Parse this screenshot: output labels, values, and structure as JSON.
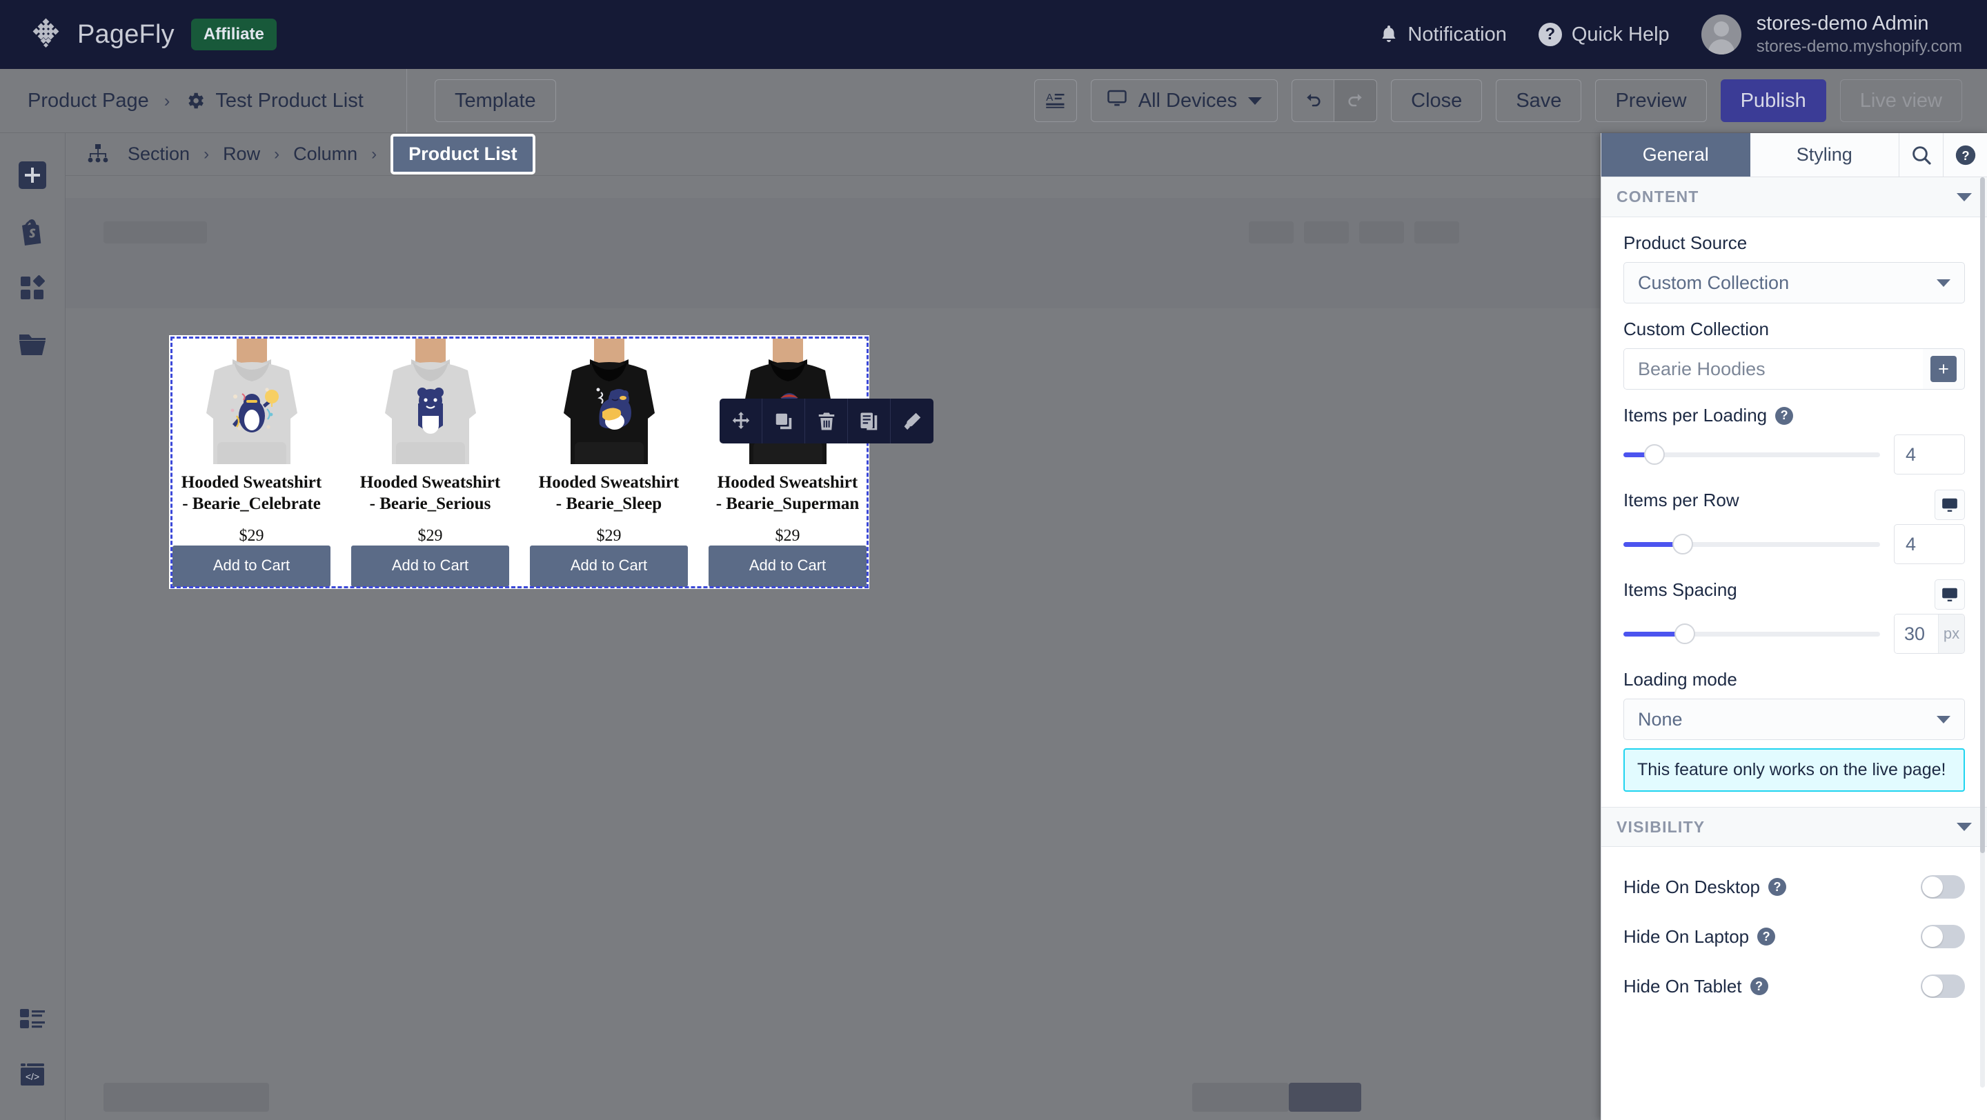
{
  "header": {
    "brand": "PageFly",
    "badge": "Affiliate",
    "notification_label": "Notification",
    "quick_help_label": "Quick Help",
    "quick_help_glyph": "?",
    "account_name": "stores-demo Admin",
    "account_domain": "stores-demo.myshopify.com",
    "bg_color": "#151a36",
    "badge_color": "#18593a"
  },
  "toolbar": {
    "breadcrumb_page": "Product Page",
    "breadcrumb_sep": "›",
    "breadcrumb_current": "Test Product List",
    "template_label": "Template",
    "device_label": "All Devices",
    "close_label": "Close",
    "save_label": "Save",
    "preview_label": "Preview",
    "publish_label": "Publish",
    "live_view_label": "Live view",
    "publish_color": "#3b3c96"
  },
  "element_breadcrumb": {
    "items": [
      {
        "label": "Section",
        "active": false
      },
      {
        "label": "Row",
        "active": false
      },
      {
        "label": "Column",
        "active": false
      },
      {
        "label": "Product List",
        "active": true
      }
    ],
    "separator": "›",
    "active_color": "#5b6b87"
  },
  "left_rail": {
    "items": [
      {
        "name": "add-element-icon"
      },
      {
        "name": "shopify-icon"
      },
      {
        "name": "elements-icon"
      },
      {
        "name": "library-folder-icon"
      }
    ],
    "bottom_items": [
      {
        "name": "layers-list-icon"
      },
      {
        "name": "custom-code-icon"
      }
    ]
  },
  "float_toolbar": {
    "items": [
      {
        "name": "move-icon"
      },
      {
        "name": "duplicate-icon"
      },
      {
        "name": "delete-icon"
      },
      {
        "name": "save-template-icon"
      },
      {
        "name": "style-paint-icon"
      }
    ]
  },
  "canvas": {
    "products": [
      {
        "title": "Hooded Sweatshirt - Bearie_Celebrate",
        "price": "$29",
        "cta": "Add to Cart",
        "hoodie_color": "#d6d6d6",
        "art": "celebrate"
      },
      {
        "title": "Hooded Sweatshirt - Bearie_Serious",
        "price": "$29",
        "cta": "Add to Cart",
        "hoodie_color": "#d6d6d6",
        "art": "serious"
      },
      {
        "title": "Hooded Sweatshirt - Bearie_Sleep",
        "price": "$29",
        "cta": "Add to Cart",
        "hoodie_color": "#141414",
        "art": "sleep"
      },
      {
        "title": "Hooded Sweatshirt - Bearie_Superman",
        "price": "$29",
        "cta": "Add to Cart",
        "hoodie_color": "#141414",
        "art": "superman"
      }
    ],
    "selection_color": "#3b48d8",
    "button_color": "#5b6b87"
  },
  "panel": {
    "tabs": [
      {
        "label": "General",
        "active": true
      },
      {
        "label": "Styling",
        "active": false
      }
    ],
    "search_icon": "search-icon",
    "help_icon": "help-icon",
    "help_glyph": "?",
    "content_section": "CONTENT",
    "visibility_section": "VISIBILITY",
    "product_source_label": "Product Source",
    "product_source_value": "Custom Collection",
    "custom_collection_label": "Custom Collection",
    "custom_collection_value": "Bearie Hoodies",
    "add_glyph": "+",
    "items_per_loading_label": "Items per Loading",
    "items_per_loading_value": "4",
    "items_per_loading_fill_pct": 12,
    "items_per_row_label": "Items per Row",
    "items_per_row_value": "4",
    "items_per_row_fill_pct": 23,
    "items_spacing_label": "Items Spacing",
    "items_spacing_value": "30",
    "items_spacing_unit": "px",
    "items_spacing_fill_pct": 24,
    "loading_mode_label": "Loading mode",
    "loading_mode_value": "None",
    "notice": "This feature only works on the live page!",
    "notice_border": "#20d4ef",
    "notice_bg": "#e2fbff",
    "help_dot_glyph": "?",
    "visibility_rows": [
      {
        "label": "Hide On Desktop",
        "on": false
      },
      {
        "label": "Hide On Laptop",
        "on": false
      },
      {
        "label": "Hide On Tablet",
        "on": false
      }
    ],
    "slider_fill_color": "#4c54ef"
  }
}
